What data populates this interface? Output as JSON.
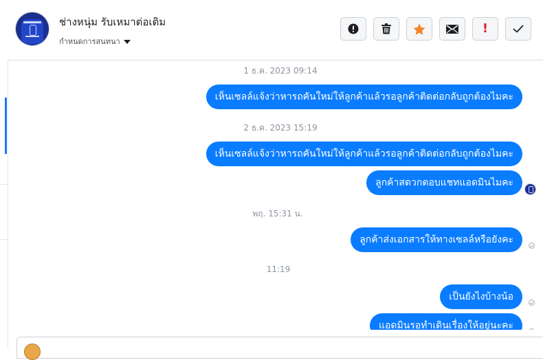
{
  "header": {
    "contact_name": "ช่างหนุ่ม รับเหมาต่อเติม",
    "conversation_setting": "กำหนดการสนทนา"
  },
  "toolbar": {
    "spam_icon": "alert-circle-icon",
    "delete_icon": "trash-icon",
    "star_icon": "star-icon",
    "mail_icon": "envelope-icon",
    "important_label": "!",
    "done_icon": "check-icon",
    "star_color": "#f5852a",
    "important_color": "#e41e3f"
  },
  "chat": {
    "accent_color": "#0a7cff",
    "items": [
      {
        "type": "timestamp",
        "text": "1 ธ.ค. 2023 09:14"
      },
      {
        "type": "message",
        "text": "เห็นเซลล์แจ้งว่าหารถคันใหม่ให้ลูกค้าแล้วรอลูกค้าติดต่อกลับถูกต้องไมคะ"
      },
      {
        "type": "timestamp",
        "text": "2 ธ.ค. 2023 15:19"
      },
      {
        "type": "message",
        "text": "เห็นเซลล์แจ้งว่าหารถคันใหม่ให้ลูกค้าแล้วรอลูกค้าติดต่อกลับถูกต้องไมคะ"
      },
      {
        "type": "message",
        "text": "ลูกค้าสดวกตอบแชทแอดมินไมคะ",
        "status": "seen-avatar"
      },
      {
        "type": "timestamp",
        "text": "พฤ. 15:31 น."
      },
      {
        "type": "message",
        "text": "ลูกค้าส่งเอกสารให้ทางเซลล์หรือยังคะ",
        "status": "sent-icon"
      },
      {
        "type": "timestamp",
        "text": "11:19"
      },
      {
        "type": "message",
        "text": "เป็นยังไงบ้างน้อ",
        "status": "sent-icon"
      },
      {
        "type": "message",
        "text": "แอดมินรอทำเดินเรื่องให้อยู่นะคะ",
        "status": "sent-icon"
      }
    ]
  }
}
